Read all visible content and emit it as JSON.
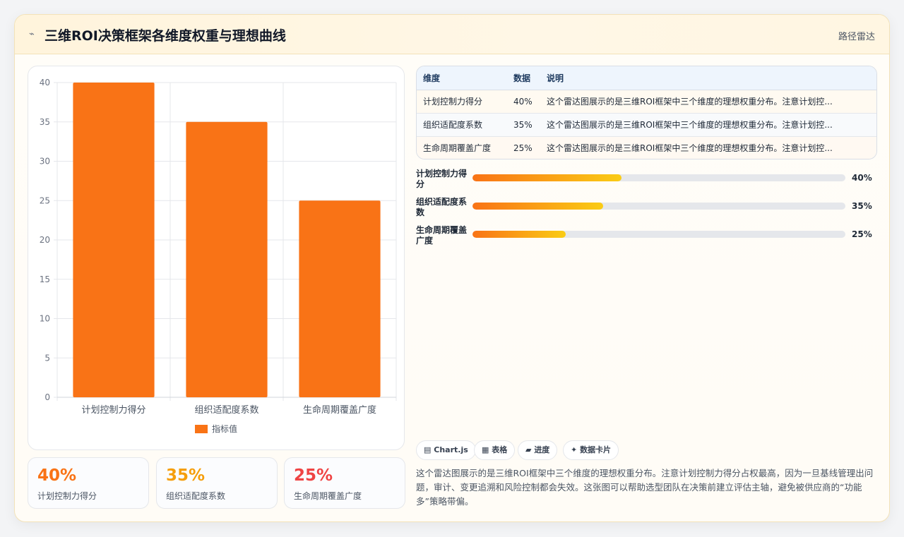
{
  "header": {
    "icon": "lightning-icon",
    "title": "三维ROI决策框架各维度权重与理想曲线",
    "tag": "路径雷达"
  },
  "chart_data": {
    "type": "bar",
    "categories": [
      "计划控制力得分",
      "组织适配度系数",
      "生命周期覆盖广度"
    ],
    "series": [
      {
        "name": "指标值",
        "values": [
          40,
          35,
          25
        ],
        "color": "#f97316"
      }
    ],
    "ylim": [
      0,
      40
    ],
    "yticks": [
      0,
      5,
      10,
      15,
      20,
      25,
      30,
      35,
      40
    ],
    "grid": true,
    "legend": "bottom"
  },
  "stats": [
    {
      "value": "40%",
      "label": "计划控制力得分",
      "color": "#f97316"
    },
    {
      "value": "35%",
      "label": "组织适配度系数",
      "color": "#f59e0b"
    },
    {
      "value": "25%",
      "label": "生命周期覆盖广度",
      "color": "#ef4444"
    }
  ],
  "table": {
    "headers": [
      "维度",
      "数据",
      "说明"
    ],
    "rows": [
      [
        "计划控制力得分",
        "40%",
        "这个雷达图展示的是三维ROI框架中三个维度的理想权重分布。注意计划控..."
      ],
      [
        "组织适配度系数",
        "35%",
        "这个雷达图展示的是三维ROI框架中三个维度的理想权重分布。注意计划控..."
      ],
      [
        "生命周期覆盖广度",
        "25%",
        "这个雷达图展示的是三维ROI框架中三个维度的理想权重分布。注意计划控..."
      ]
    ]
  },
  "progress": [
    {
      "label": "计划控制力得分",
      "value": 40,
      "text": "40%"
    },
    {
      "label": "组织适配度系数",
      "value": 35,
      "text": "35%"
    },
    {
      "label": "生命周期覆盖广度",
      "value": 25,
      "text": "25%"
    }
  ],
  "chips": [
    {
      "icon": "▤",
      "label": "Chart.js"
    },
    {
      "icon": "▦",
      "label": "表格"
    },
    {
      "icon": "▰",
      "label": "进度"
    },
    {
      "icon": "✦",
      "label": "数据卡片"
    }
  ],
  "description": "这个雷达图展示的是三维ROI框架中三个维度的理想权重分布。注意计划控制力得分占权最高，因为一旦基线管理出问题，审计、变更追溯和风险控制都会失效。这张图可以帮助选型团队在决策前建立评估主轴，避免被供应商的“功能多”策略带偏。"
}
